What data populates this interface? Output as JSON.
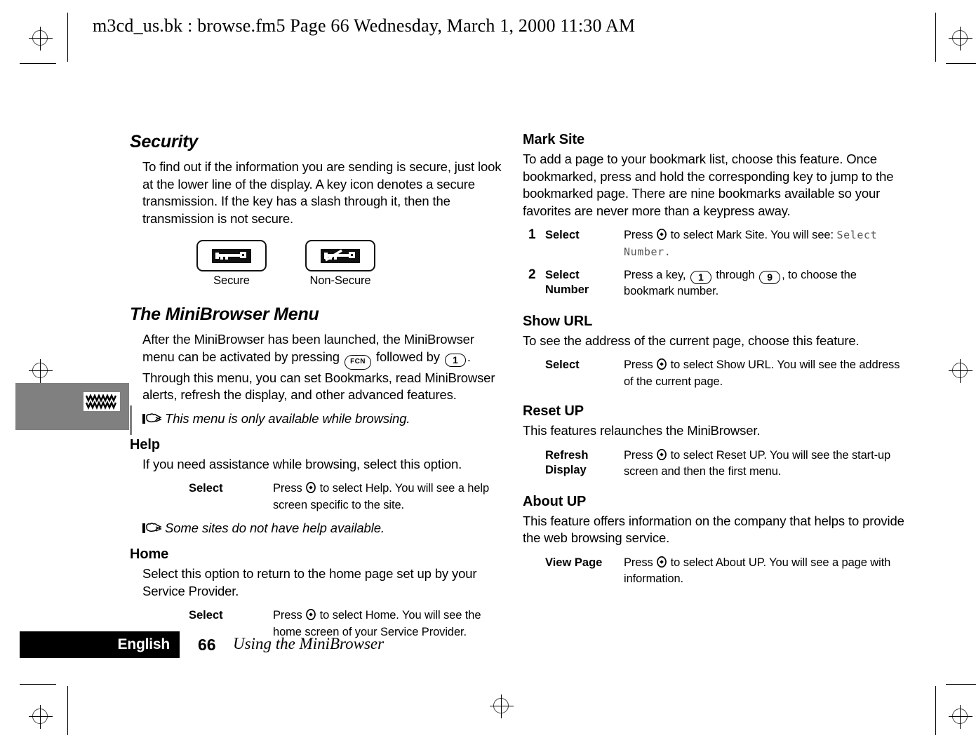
{
  "doc_header": "m3cd_us.bk : browse.fm5  Page 66  Wednesday, March 1, 2000  11:30 AM",
  "thumb_tab": {
    "icon": "www-icon"
  },
  "left_column": {
    "security": {
      "title": "Security",
      "paragraph": "To find out if the information you are sending is secure, just look at the lower line of the display. A key icon denotes a secure transmission. If the key has a slash through it, then the transmission is not secure.",
      "icons": [
        {
          "caption": "Secure",
          "icon": "key-icon"
        },
        {
          "caption": "Non-Secure",
          "icon": "key-slashed-icon"
        }
      ]
    },
    "minibrowser_menu": {
      "title": "The MiniBrowser Menu",
      "paragraph_part1": "After the MiniBrowser has been launched, the MiniBrowser menu can be activated by pressing",
      "key_fcn": "FCN",
      "paragraph_part2": "followed by",
      "key_one": "1",
      "paragraph_part3": ". Through this menu, you can set Bookmarks, read MiniBrowser alerts, refresh the display, and other advanced features.",
      "note": "This menu is only available while browsing."
    },
    "help": {
      "title": "Help",
      "paragraph": "If you need assistance while browsing, select this option.",
      "steps": [
        {
          "num": "",
          "label": "Select",
          "text_part1": "Press",
          "key": "select-key-icon",
          "text_part2": "to select Help. You will see a help screen specific to the site."
        }
      ],
      "note": "Some sites do not have help available."
    },
    "home": {
      "title": "Home",
      "paragraph": "Select this option to return to the home page set up by your Service Provider.",
      "steps": [
        {
          "num": "",
          "label": "Select",
          "text_part1": "Press",
          "key": "select-key-icon",
          "text_part2": "to select Home. You will see the home screen of your Service Provider."
        }
      ]
    }
  },
  "right_column": {
    "mark_site": {
      "title": "Mark Site",
      "paragraph": "To add a page to your bookmark list, choose this feature. Once bookmarked, press and hold the corresponding key to jump to the bookmarked page. There are nine bookmarks available so your favorites are never more than a keypress away.",
      "steps": [
        {
          "num": "1",
          "label": "Select",
          "text_part1": "Press",
          "key": "select-key-icon",
          "text_part2": "to select Mark Site. You will see:",
          "lcd_text": "Select Number",
          "text_part3": "."
        },
        {
          "num": "2",
          "label": "Select Number",
          "text_part1": "Press a key,",
          "key_from": "1",
          "text_part2": "through",
          "key_to": "9",
          "text_part3": ", to choose the bookmark number."
        }
      ]
    },
    "show_url": {
      "title": "Show URL",
      "paragraph": "To see the address of the current page, choose this feature.",
      "steps": [
        {
          "num": "",
          "label": "Select",
          "text_part1": "Press",
          "key": "select-key-icon",
          "text_part2": "to select Show URL. You will see the address of the current page."
        }
      ]
    },
    "reset_up": {
      "title": "Reset UP",
      "paragraph": "This features relaunches the MiniBrowser.",
      "steps": [
        {
          "num": "",
          "label": "Refresh Display",
          "text_part1": "Press",
          "key": "select-key-icon",
          "text_part2": "to select Reset UP. You will see the start-up screen and then the first menu."
        }
      ]
    },
    "about_up": {
      "title": "About UP",
      "paragraph": "This feature offers information on the company that helps to provide the web browsing service.",
      "steps": [
        {
          "num": "",
          "label": "View Page",
          "text_part1": "Press",
          "key": "select-key-icon",
          "text_part2": "to select About UP. You will see a page with information."
        }
      ]
    }
  },
  "footer": {
    "language": "English",
    "page_number": "66",
    "chapter": "Using the MiniBrowser"
  }
}
